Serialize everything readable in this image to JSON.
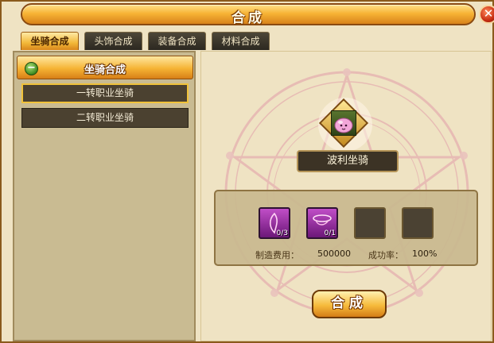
{
  "window": {
    "title": "合成",
    "close_symbol": "✕"
  },
  "tabs": [
    {
      "label": "坐骑合成",
      "active": true
    },
    {
      "label": "头饰合成",
      "active": false
    },
    {
      "label": "装备合成",
      "active": false
    },
    {
      "label": "材料合成",
      "active": false
    }
  ],
  "sidebar": {
    "group": {
      "label": "坐骑合成",
      "toggle_symbol": "−",
      "toggle_icon": "collapse-minus-icon"
    },
    "items": [
      {
        "label": "一转职业坐骑",
        "selected": true
      },
      {
        "label": "二转职业坐骑",
        "selected": false
      }
    ]
  },
  "result": {
    "name": "波利坐骑",
    "icon": "poring-mount-icon"
  },
  "materials": [
    {
      "icon": "pink-feather-icon",
      "count": "0/3"
    },
    {
      "icon": "pink-ring-icon",
      "count": "0/1"
    },
    {
      "icon": "empty-slot",
      "count": ""
    },
    {
      "icon": "empty-slot",
      "count": ""
    }
  ],
  "cost": {
    "label": "制造费用：",
    "value": "500000"
  },
  "success_rate": {
    "label": "成功率：",
    "value": "100%"
  },
  "craft_button": {
    "label": "合成"
  },
  "colors": {
    "accent_orange": "#f5b334",
    "frame_brown": "#8a5a1c",
    "panel_dark": "#4b4130"
  }
}
